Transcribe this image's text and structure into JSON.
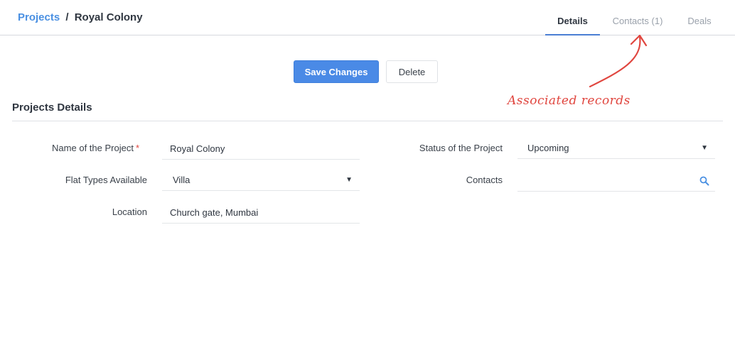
{
  "breadcrumb": {
    "parent": "Projects",
    "separator": "/",
    "current": "Royal Colony"
  },
  "tabs": [
    {
      "label": "Details",
      "active": true
    },
    {
      "label": "Contacts (1)",
      "active": false
    },
    {
      "label": "Deals",
      "active": false
    }
  ],
  "actions": {
    "save_label": "Save Changes",
    "delete_label": "Delete"
  },
  "annotation": {
    "text": "Associated records"
  },
  "section": {
    "title": "Projects Details"
  },
  "form": {
    "name": {
      "label": "Name of the Project",
      "required_mark": "*",
      "value": "Royal Colony"
    },
    "flat_types": {
      "label": "Flat Types Available",
      "value": "Villa"
    },
    "location": {
      "label": "Location",
      "value": "Church gate, Mumbai"
    },
    "status": {
      "label": "Status of the Project",
      "value": "Upcoming"
    },
    "contacts": {
      "label": "Contacts",
      "value": ""
    }
  },
  "colors": {
    "accent": "#4a8ae6",
    "link": "#4a90e2",
    "annotation": "#e0463f",
    "required": "#e0463f"
  },
  "icons": {
    "dropdown": "caret-down-icon",
    "search": "search-icon",
    "arrow": "curved-arrow-icon"
  }
}
